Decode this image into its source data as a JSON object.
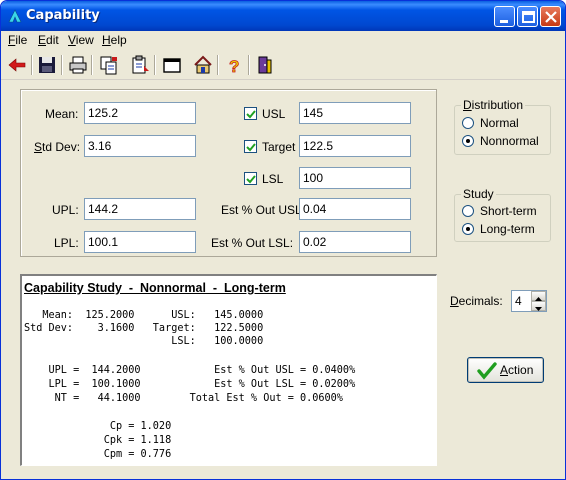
{
  "window": {
    "title": "Capability"
  },
  "menu": [
    {
      "label": "File",
      "ul": "F",
      "rest": "ile"
    },
    {
      "label": "Edit",
      "ul": "E",
      "rest": "dit"
    },
    {
      "label": "View",
      "ul": "V",
      "rest": "iew"
    },
    {
      "label": "Help",
      "ul": "H",
      "rest": "elp"
    }
  ],
  "toolbar": [
    "back-arrow-icon",
    "save-icon",
    "print-icon",
    "copy-icon",
    "paste-icon",
    "window-icon",
    "home-icon",
    "help-icon",
    "exit-icon"
  ],
  "inputs": {
    "mean": {
      "label": "Mean:",
      "value": "125.2"
    },
    "std_dev": {
      "label_u": "S",
      "label_rest": "td Dev:",
      "value": "3.16"
    },
    "upl": {
      "label": "UPL:",
      "value": "144.2"
    },
    "lpl": {
      "label": "LPL:",
      "value": "100.1"
    },
    "usl": {
      "label": "USL",
      "value": "145",
      "checked": true
    },
    "target": {
      "label": "Target",
      "value": "122.5",
      "checked": true
    },
    "lsl": {
      "label": "LSL",
      "value": "100",
      "checked": true
    },
    "est_out_usl": {
      "label": "Est % Out USL:",
      "value": "0.04"
    },
    "est_out_lsl": {
      "label": "Est % Out LSL:",
      "value": "0.02"
    }
  },
  "distribution": {
    "title_u": "D",
    "title_rest": "istribution",
    "options": [
      "Normal",
      "Nonnormal"
    ],
    "selected": "Nonnormal"
  },
  "study": {
    "title": "Study",
    "options": [
      "Short-term",
      "Long-term"
    ],
    "selected": "Long-term"
  },
  "decimals": {
    "label_u": "D",
    "label_rest": "ecimals:",
    "value": "4"
  },
  "action": {
    "label_u": "A",
    "label_rest": "ction"
  },
  "report": {
    "title": "Capability Study  -  Nonnormal  -  Long-term",
    "lines": [
      "   Mean:  125.2000      USL:   145.0000",
      "Std Dev:    3.1600   Target:   122.5000",
      "                        LSL:   100.0000",
      "",
      "    UPL =  144.2000            Est % Out USL = 0.0400%",
      "    LPL =  100.1000            Est % Out LSL = 0.0200%",
      "     NT =   44.1000        Total Est % Out = 0.0600%",
      "",
      "              Cp = 1.020",
      "             Cpk = 1.118",
      "             Cpm = 0.776"
    ]
  },
  "colors": {
    "titlebar": "#0055e5",
    "checkmark_green": "#1f9e1f",
    "window_bg": "#ece9d8"
  }
}
